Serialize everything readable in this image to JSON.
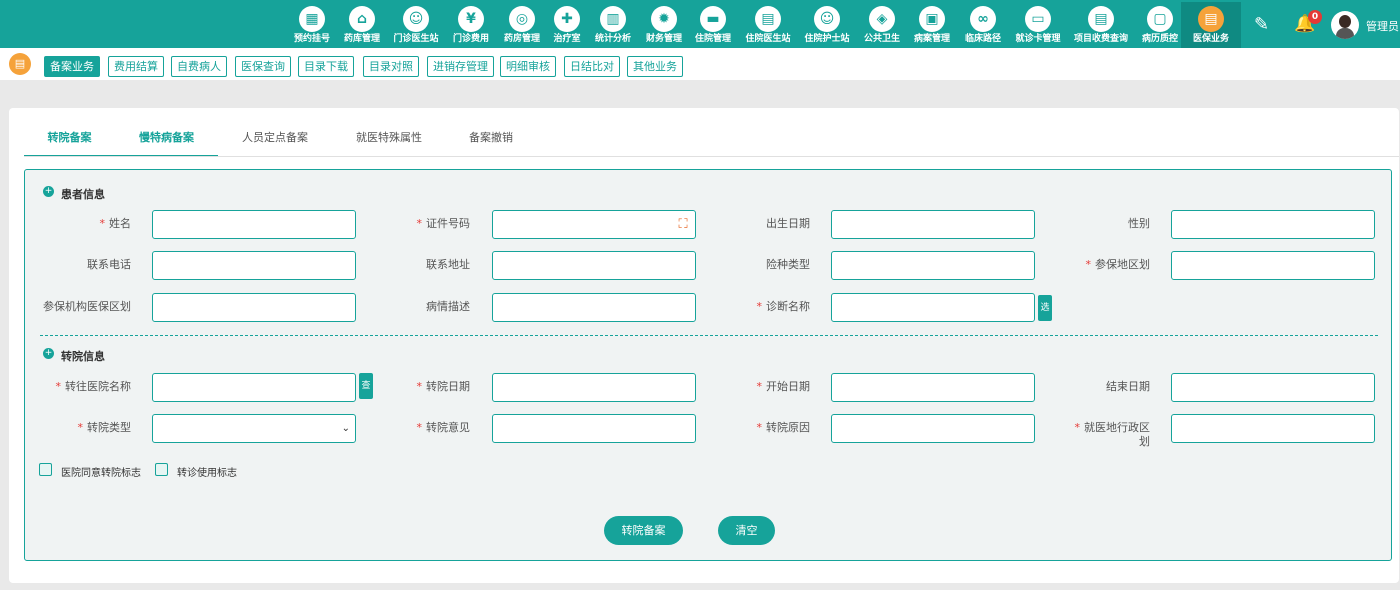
{
  "topnav": {
    "items": [
      {
        "label": "预约挂号",
        "icon": "calendar-icon"
      },
      {
        "label": "药库管理",
        "icon": "house-icon"
      },
      {
        "label": "门诊医生站",
        "icon": "doctor-icon"
      },
      {
        "label": "门诊费用",
        "icon": "yen-icon"
      },
      {
        "label": "药房管理",
        "icon": "pill-icon"
      },
      {
        "label": "治疗室",
        "icon": "treatment-icon"
      },
      {
        "label": "统计分析",
        "icon": "chart-icon"
      },
      {
        "label": "财务管理",
        "icon": "gear-icon"
      },
      {
        "label": "住院管理",
        "icon": "bed-icon"
      },
      {
        "label": "住院医生站",
        "icon": "doctor-card-icon"
      },
      {
        "label": "住院护士站",
        "icon": "nurse-icon"
      },
      {
        "label": "公共卫生",
        "icon": "diamond-icon"
      },
      {
        "label": "病案管理",
        "icon": "folder-icon"
      },
      {
        "label": "临床路径",
        "icon": "path-icon"
      },
      {
        "label": "就诊卡管理",
        "icon": "card-icon"
      },
      {
        "label": "项目收费查询",
        "icon": "receipt-icon"
      },
      {
        "label": "病历质控",
        "icon": "record-icon"
      },
      {
        "label": "医保业务",
        "icon": "insurance-icon"
      }
    ],
    "icon_glyphs": [
      "▦",
      "⌂",
      "☺",
      "¥",
      "◎",
      "✚",
      "▥",
      "✹",
      "▬",
      "▤",
      "☺",
      "◈",
      "▣",
      "∞",
      "▭",
      "▤",
      "▢",
      "▤"
    ],
    "notification_count": "0",
    "username": "管理员"
  },
  "subnav": {
    "items": [
      "备案业务",
      "费用结算",
      "自费病人",
      "医保查询",
      "目录下载",
      "目录对照",
      "进销存管理",
      "明细审核",
      "日结比对",
      "其他业务"
    ]
  },
  "tabs": [
    "转院备案",
    "慢特病备案",
    "人员定点备案",
    "就医特殊属性",
    "备案撤销"
  ],
  "patient_section": {
    "title": "患者信息",
    "fields": {
      "name": "姓名",
      "id_number": "证件号码",
      "birth_date": "出生日期",
      "gender": "性别",
      "phone": "联系电话",
      "address": "联系地址",
      "insurance_type": "险种类型",
      "insured_region": "参保地区划",
      "insured_org_region": "参保机构医保区划",
      "condition_desc": "病情描述",
      "diagnosis_name": "诊断名称"
    },
    "select_btn": "选"
  },
  "transfer_section": {
    "title": "转院信息",
    "fields": {
      "target_hospital": "转往医院名称",
      "transfer_date": "转院日期",
      "start_date": "开始日期",
      "end_date": "结束日期",
      "transfer_type": "转院类型",
      "transfer_opinion": "转院意见",
      "transfer_reason": "转院原因",
      "admin_region_1": "就医地行政区",
      "admin_region_2": "划"
    },
    "query_btn": "查",
    "checkboxes": [
      "医院同意转院标志",
      "转诊使用标志"
    ]
  },
  "actions": {
    "submit": "转院备案",
    "clear": "清空"
  }
}
